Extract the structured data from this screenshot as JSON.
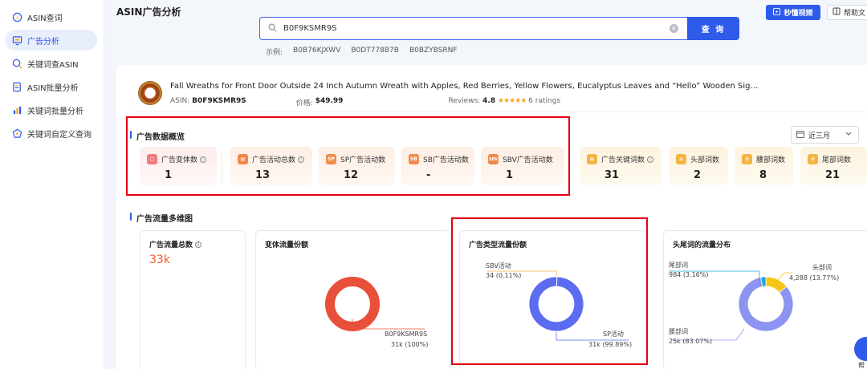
{
  "sidebar": {
    "items": [
      {
        "label": "ASIN查词",
        "icon": "asin-search-icon",
        "active": false
      },
      {
        "label": "广告分析",
        "icon": "ad-analysis-icon",
        "active": true
      },
      {
        "label": "关键词查ASIN",
        "icon": "keyword-lookup-icon",
        "active": false
      },
      {
        "label": "ASIN批量分析",
        "icon": "batch-asin-icon",
        "active": false
      },
      {
        "label": "关键词批量分析",
        "icon": "batch-keyword-icon",
        "active": false
      },
      {
        "label": "关键词自定义查询",
        "icon": "custom-query-icon",
        "active": false
      }
    ]
  },
  "header": {
    "title": "ASIN广告分析",
    "video_label": "秒懂视频",
    "help_label": "帮助文"
  },
  "search": {
    "value": "B0F9KSMR9S",
    "button_label": "查 询",
    "examples_label": "示例:",
    "examples": [
      "B0B76KJXWV",
      "B0DT778B7B",
      "B0BZYBSRNF"
    ]
  },
  "product": {
    "title": "Fall Wreaths for Front Door Outside 24 Inch Autumn Wreath with Apples, Red Berries, Yellow Flowers, Eucalyptus Leaves and “Hello” Wooden Sig…",
    "asin_label": "ASIN:",
    "asin": "B0F9KSMR9S",
    "price_label": "价格:",
    "price": "$49.99",
    "reviews_label": "Reviews:",
    "rating": "4.8",
    "stars": "★★★★★",
    "ratings_count": "6 ratings"
  },
  "overview": {
    "title": "广告数据概览",
    "date_range": "近三月",
    "stats": [
      {
        "label": "广告变体数",
        "value": "1",
        "icon_text": ""
      },
      {
        "label": "广告活动总数",
        "value": "13",
        "icon_text": ""
      },
      {
        "label": "SP广告活动数",
        "value": "12",
        "icon_text": "SP"
      },
      {
        "label": "SB广告活动数",
        "value": "-",
        "icon_text": "SB"
      },
      {
        "label": "SBV广告活动数",
        "value": "1",
        "icon_text": "SBV"
      },
      {
        "label": "广告关键词数",
        "value": "31",
        "icon_text": ""
      },
      {
        "label": "头部词数",
        "value": "2",
        "icon_text": ""
      },
      {
        "label": "腰部词数",
        "value": "8",
        "icon_text": ""
      },
      {
        "label": "尾部词数",
        "value": "21",
        "icon_text": ""
      }
    ]
  },
  "traffic": {
    "title": "广告流量多维图",
    "total": {
      "title": "广告流量总数",
      "value": "33k"
    },
    "variant_share": {
      "title": "变体流量份额",
      "segments": [
        {
          "label": "B0F9KSMR9S",
          "value": "31k (100%)",
          "fraction": 1.0,
          "color": "#e8503a"
        }
      ]
    },
    "type_share": {
      "title": "广告类型流量份额",
      "segments": [
        {
          "label": "SBV活动",
          "value": "34 (0.11%)",
          "fraction": 0.0011,
          "color": "#f5b342"
        },
        {
          "label": "SP活动",
          "value": "31k (99.89%)",
          "fraction": 0.9989,
          "color": "#5b6cf0"
        }
      ]
    },
    "headtail": {
      "title": "头尾词的流量分布",
      "segments": [
        {
          "label": "尾部词",
          "value": "984 (3.16%)",
          "fraction": 0.0316,
          "color": "#1ea7e0"
        },
        {
          "label": "头部词",
          "value": "4,288 (13.77%)",
          "fraction": 0.1377,
          "color": "#f5c518"
        },
        {
          "label": "腰部词",
          "value": "25k (83.07%)",
          "fraction": 0.8307,
          "color": "#8c93f0"
        }
      ]
    }
  },
  "float_label": "帮助"
}
